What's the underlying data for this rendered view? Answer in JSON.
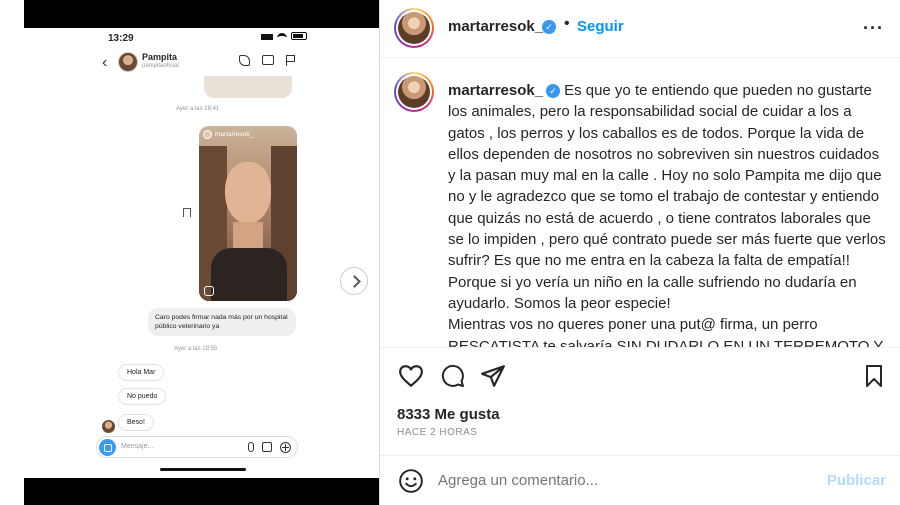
{
  "phone": {
    "status_time": "13:29",
    "chat_name": "Pampita",
    "chat_handle": "pampitaoficial",
    "timestamp_1": "Ayer a las 18:41",
    "shared_post_user": "martarresok_",
    "outgoing_message": "Caro podes firmar nada más por un hospital público veterinario ya",
    "timestamp_2": "Ayer a las 19:55",
    "incoming_messages": [
      "Hola Mar",
      "No puedo",
      "Beso!"
    ],
    "composer_placeholder": "Mensaje..."
  },
  "post": {
    "username": "martarresok_",
    "verified_mark": "✓",
    "separator": "•",
    "follow_label": "Seguir",
    "more_label": "···",
    "caption_user": "martarresok_",
    "caption_text": "Es que yo te entiendo que pueden no gustarte los animales, pero la responsabilidad social de cuidar a los a gatos , los perros y los caballos es de todos. Porque la vida de ellos dependen de nosotros no sobreviven sin nuestros cuidados y la pasan muy mal en la calle . Hoy no solo Pampita me dijo que no y le agradezco que se tomo el trabajo de contestar y entiendo que quizás no está de acuerdo , o tiene contratos laborales que se lo impiden , pero qué contrato puede ser más fuerte que verlos sufrir? Es que no me entra en la cabeza la falta de empatía!! Porque si yo vería un niño en la calle sufriendo no dudaría en ayudarlo. Somos la peor especie!",
    "caption_text_2": "Mientras vos no queres poner una put@ firma, un perro RESCATISTA te salvaría SIN DUDARLO EN UN TERREMOTO Y",
    "likes": "8333 Me gusta",
    "time_ago": "HACE 2 HORAS",
    "comment_placeholder": "Agrega un comentario...",
    "publish_label": "Publicar"
  },
  "colors": {
    "accent": "#0095f6",
    "publish_disabled": "#b3dbff",
    "verified": "#3897f0",
    "text": "#262626",
    "muted": "#8e8e8e"
  },
  "icons": [
    "heart-icon",
    "comment-icon",
    "share-icon",
    "bookmark-icon",
    "emoji-icon",
    "verified-icon",
    "more-icon",
    "chevron-right-icon"
  ]
}
